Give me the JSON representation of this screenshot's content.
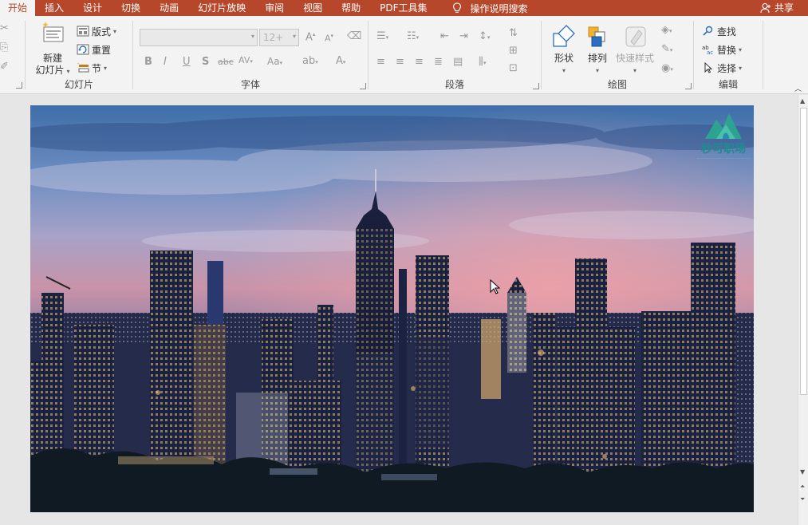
{
  "tabs": [
    "开始",
    "插入",
    "设计",
    "切换",
    "动画",
    "幻灯片放映",
    "审阅",
    "视图",
    "帮助",
    "PDF工具集"
  ],
  "active_tab": "开始",
  "tell_me": "操作说明搜索",
  "share": "共享",
  "ribbon": {
    "slides": {
      "label": "幻灯片",
      "new_slide_line1": "新建",
      "new_slide_line2": "幻灯片",
      "layout": "版式",
      "reset": "重置",
      "section": "节"
    },
    "font": {
      "label": "字体",
      "font_name": "",
      "font_size": "12+"
    },
    "paragraph": {
      "label": "段落"
    },
    "drawing": {
      "label": "绘图",
      "shapes": "形状",
      "arrange": "排列",
      "quick_styles": "快速样式"
    },
    "editing": {
      "label": "编辑",
      "find": "查找",
      "replace": "替换",
      "select": "选择"
    }
  },
  "watermark": {
    "title": "秒可职场"
  },
  "colors": {
    "accent": "#b7472a",
    "ribbon_bg": "#f3f3f3"
  }
}
